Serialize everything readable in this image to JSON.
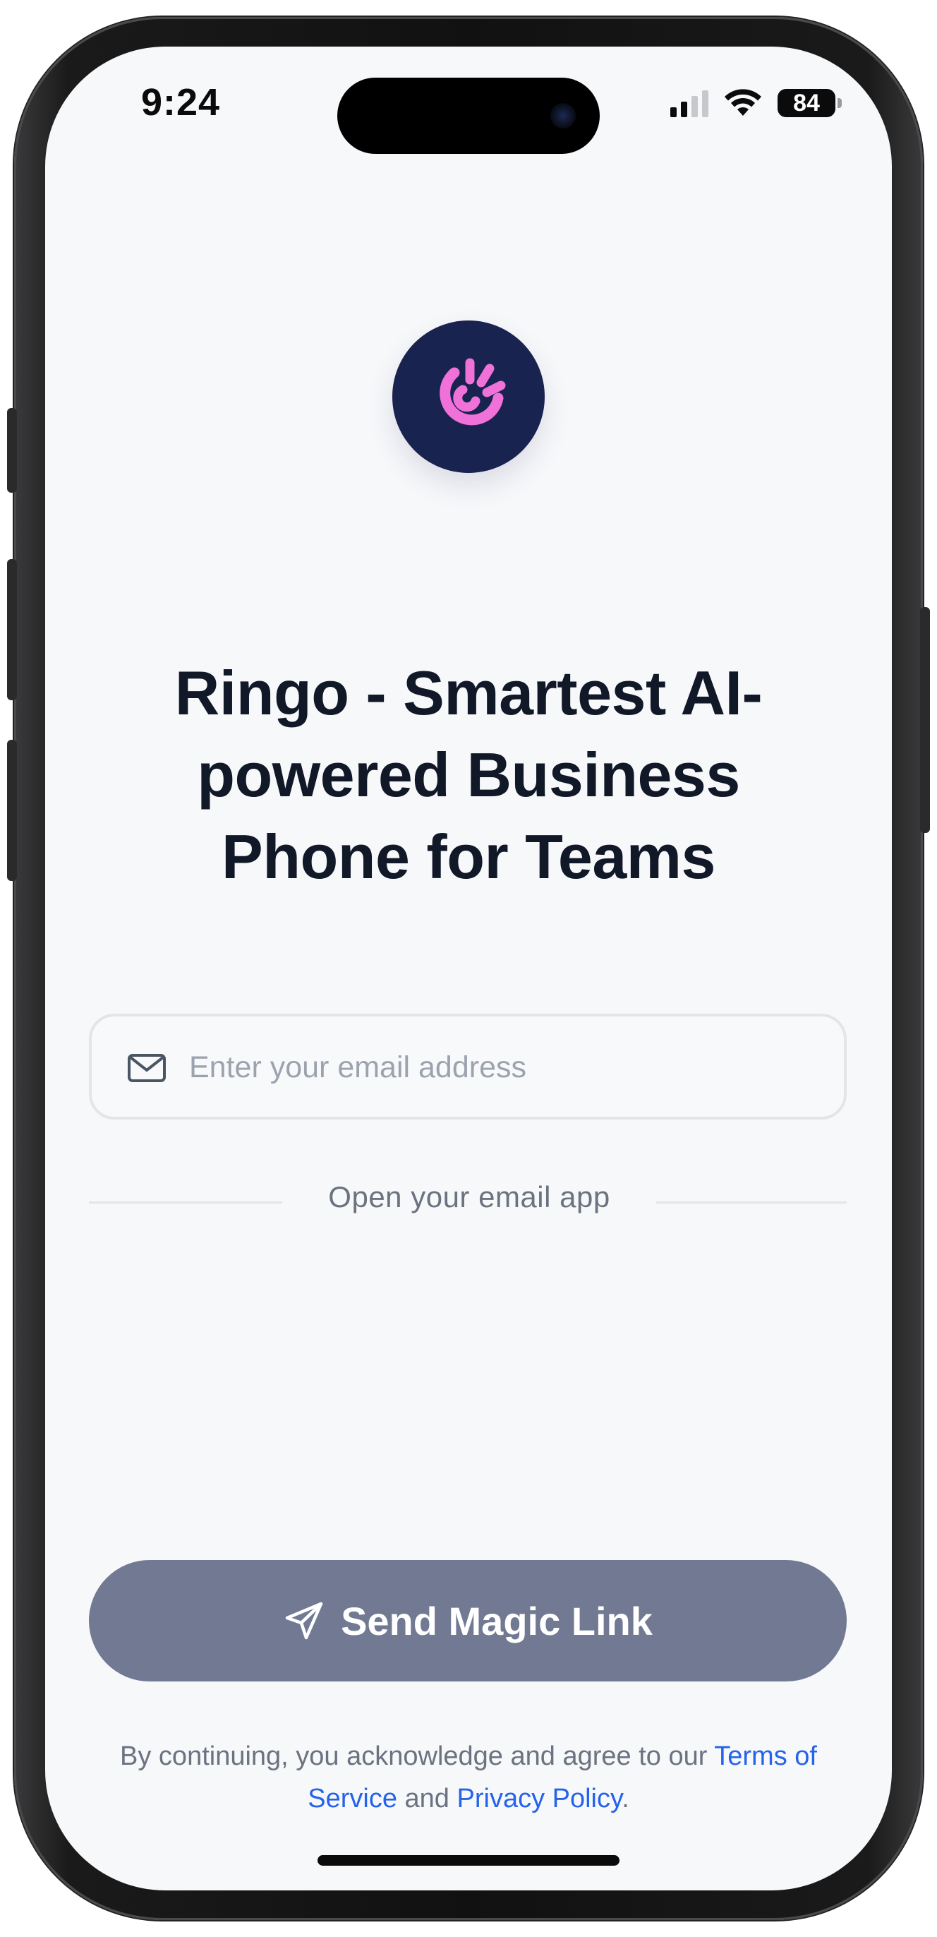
{
  "status_bar": {
    "time": "9:24",
    "battery": "84",
    "icons": [
      "cellular-signal-icon",
      "wifi-icon",
      "battery-icon"
    ]
  },
  "app": {
    "logo_icon": "ringo-logo-icon",
    "logo_colors": {
      "background": "#19234f",
      "mark": "#f072d9"
    },
    "headline": "Ringo - Smartest AI-powered Business Phone for Teams"
  },
  "login": {
    "email_placeholder": "Enter your email address",
    "email_value": "",
    "email_icon": "mail-icon",
    "divider_text": "Open your email app",
    "send_button_label": "Send Magic Link",
    "send_button_icon": "send-icon",
    "send_button_color": "#717993"
  },
  "legal": {
    "prefix": "By continuing, you acknowledge and agree to our ",
    "terms_link": "Terms of Service",
    "middle": " and ",
    "privacy_link": "Privacy Policy",
    "suffix": ".",
    "link_color": "#2563eb"
  }
}
